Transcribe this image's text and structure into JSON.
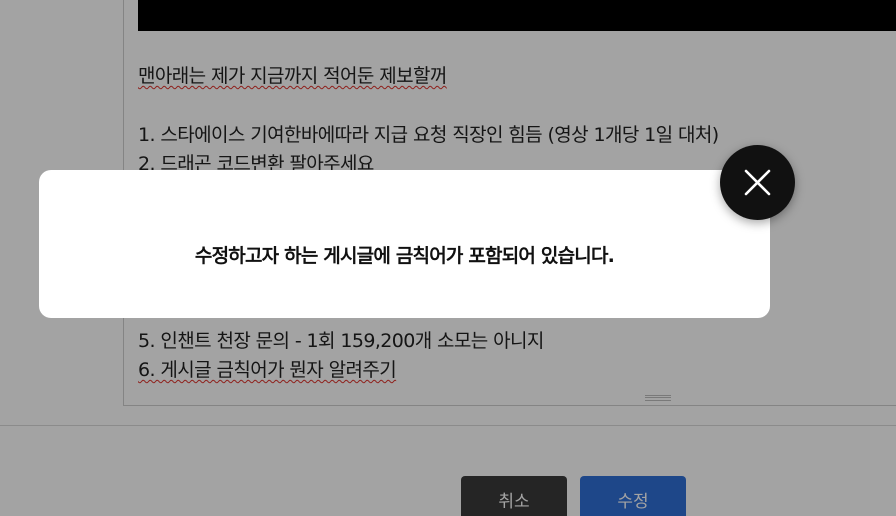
{
  "editor": {
    "lines": [
      "맨아래는 제가 지금까지 적어둔 제보할꺼",
      "1. 스타에이스 기여한바에따라 지급 요청 직장인 힘듬 (영상 1개당 1일 대처)",
      "2. 드래곤 코드변환 팔아주세요",
      "5. 인챈트 천장 문의 - 1회 159,200개 소모는 아니지",
      "6. 게시글 금칙어가 뭔자 알려주기"
    ]
  },
  "buttons": {
    "cancel_label": "취소",
    "submit_label": "수정"
  },
  "modal": {
    "message": "수정하고자 하는 게시글에 금칙어가 포함되어 있습니다."
  },
  "icons": {
    "close": "close-icon"
  },
  "colors": {
    "overlay": "#5b5b5b",
    "submit_button": "#2f6fd6",
    "cancel_button": "#3a3a3a",
    "spellcheck_underline": "#e0312b",
    "close_button": "#111111"
  }
}
